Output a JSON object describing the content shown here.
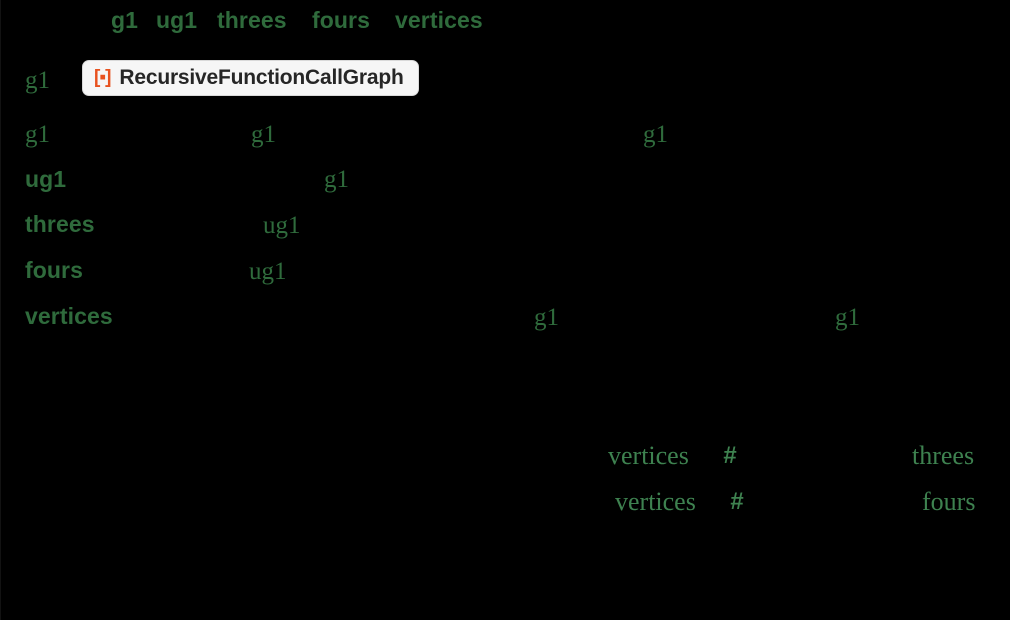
{
  "window": {
    "title": "RecursiveFunctionCallGraph",
    "background_color": "#000000"
  },
  "colors": {
    "symbol_green": "#2f6b3c",
    "symbol_green_light": "#3e8250",
    "pill_background": "#f6f6f6",
    "pill_border": "#d9d9d9",
    "pill_badge_orange": "#e8521f",
    "pill_text": "#262626"
  },
  "header_row": {
    "name": "module-variable-list",
    "items": [
      {
        "label": "g1"
      },
      {
        "label": "ug1"
      },
      {
        "label": "threes"
      },
      {
        "label": "fours"
      },
      {
        "label": "vertices"
      }
    ]
  },
  "pill": {
    "badge": "[▪]",
    "badge_icon": "wolfram-resource-icon",
    "label": "RecursiveFunctionCallGraph"
  },
  "assignment_rows": [
    {
      "name": "row-g1-definition",
      "lhs": "g1",
      "tokens": []
    },
    {
      "name": "row-g1-body",
      "lhs": "g1",
      "tokens": [
        {
          "label": "g1"
        },
        {
          "label": "g1"
        }
      ]
    },
    {
      "name": "row-ug1",
      "lhs": "ug1",
      "tokens": [
        {
          "label": "g1"
        }
      ]
    },
    {
      "name": "row-threes",
      "lhs": "threes",
      "tokens": [
        {
          "label": "ug1"
        }
      ]
    },
    {
      "name": "row-fours",
      "lhs": "fours",
      "tokens": [
        {
          "label": "ug1"
        }
      ]
    },
    {
      "name": "row-vertices",
      "lhs": "vertices",
      "tokens": [
        {
          "label": "g1"
        },
        {
          "label": "g1"
        }
      ]
    }
  ],
  "lower_rows": [
    {
      "name": "row-threes-selection",
      "tokens": [
        {
          "label": "vertices"
        },
        {
          "label": "#"
        },
        {
          "label": "threes"
        }
      ]
    },
    {
      "name": "row-fours-selection",
      "tokens": [
        {
          "label": "vertices"
        },
        {
          "label": "#"
        },
        {
          "label": "fours"
        }
      ]
    }
  ]
}
